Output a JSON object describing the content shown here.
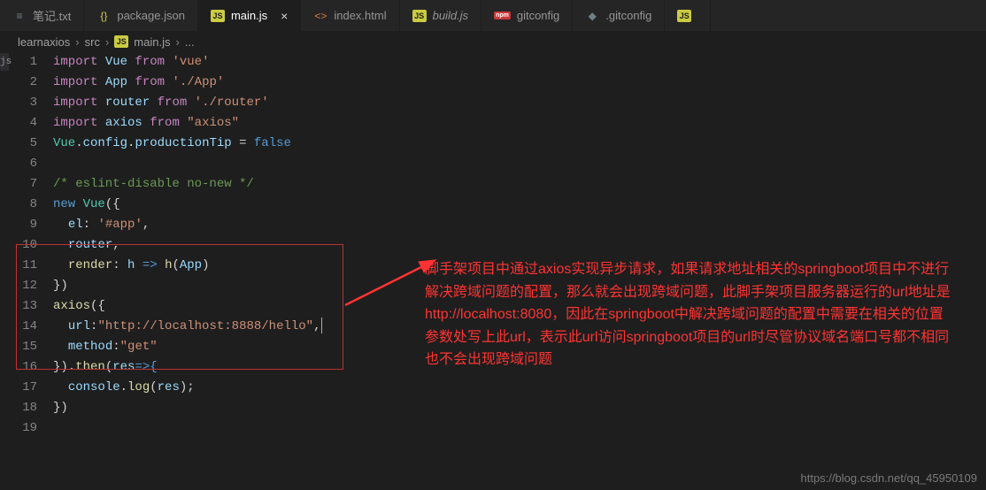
{
  "tabs": [
    {
      "icon": "txt",
      "iconGlyph": "≡",
      "label": "笔记.txt"
    },
    {
      "icon": "json",
      "iconGlyph": "{}",
      "label": "package.json"
    },
    {
      "icon": "js",
      "iconGlyph": "JS",
      "label": "main.js",
      "active": true,
      "close": "×"
    },
    {
      "icon": "html",
      "iconGlyph": "<>",
      "label": "index.html"
    },
    {
      "icon": "js",
      "iconGlyph": "JS",
      "label": "build.js",
      "italic": true
    },
    {
      "icon": "npm",
      "iconGlyph": "npm",
      "label": "gitconfig"
    },
    {
      "icon": "gear",
      "iconGlyph": "◆",
      "label": ".gitconfig"
    },
    {
      "icon": "js",
      "iconGlyph": "JS",
      "label": ""
    }
  ],
  "breadcrumb": {
    "seg0": "learnaxios",
    "seg1": "src",
    "seg2_icon": "JS",
    "seg2": "main.js",
    "seg3": "..."
  },
  "left_stub": "js",
  "code": {
    "l1_kw": "import",
    "l1_var": "Vue",
    "l1_from": "from",
    "l1_str": "'vue'",
    "l2_kw": "import",
    "l2_var": "App",
    "l2_from": "from",
    "l2_str": "'./App'",
    "l3_kw": "import",
    "l3_var": "router",
    "l3_from": "from",
    "l3_str": "'./router'",
    "l4_kw": "import",
    "l4_var": "axios",
    "l4_from": "from",
    "l4_str": "\"axios\"",
    "l5_a": "Vue",
    "l5_b": ".",
    "l5_c": "config",
    "l5_d": ".",
    "l5_e": "productionTip",
    "l5_f": " = ",
    "l5_g": "false",
    "l7": "/* eslint-disable no-new */",
    "l8_kw": "new",
    "l8_cls": "Vue",
    "l8_p": "({",
    "l9_a": "el",
    "l9_b": ": ",
    "l9_c": "'#app'",
    "l9_d": ",",
    "l10": "router",
    "l10_c": ",",
    "l11_a": "render",
    "l11_b": ": ",
    "l11_c": "h",
    "l11_d": " => ",
    "l11_e": "h",
    "l11_f": "(",
    "l11_g": "App",
    "l11_h": ")",
    "l12": "})",
    "l13_a": "axios",
    "l13_b": "({",
    "l14_a": "url",
    "l14_b": ":",
    "l14_c": "\"http://localhost:8888/hello\"",
    "l14_d": ",",
    "l15_a": "method",
    "l15_b": ":",
    "l15_c": "\"get\"",
    "l16_a": "}).",
    "l16_b": "then",
    "l16_c": "(",
    "l16_d": "res",
    "l16_e": "=>{",
    "l17_a": "console",
    "l17_b": ".",
    "l17_c": "log",
    "l17_d": "(",
    "l17_e": "res",
    "l17_f": ");",
    "l18": "})"
  },
  "lineCount": 19,
  "annotation": "脚手架项目中通过axios实现异步请求，如果请求地址相关的springboot项目中不进行解决跨域问题的配置，那么就会出现跨域问题，此脚手架项目服务器运行的url地址是http://localhost:8080，因此在springboot中解决跨域问题的配置中需要在相关的位置参数处写上此url，表示此url访问springboot项目的url时尽管协议域名端口号都不相同也不会出现跨域问题",
  "watermark": "https://blog.csdn.net/qq_45950109"
}
